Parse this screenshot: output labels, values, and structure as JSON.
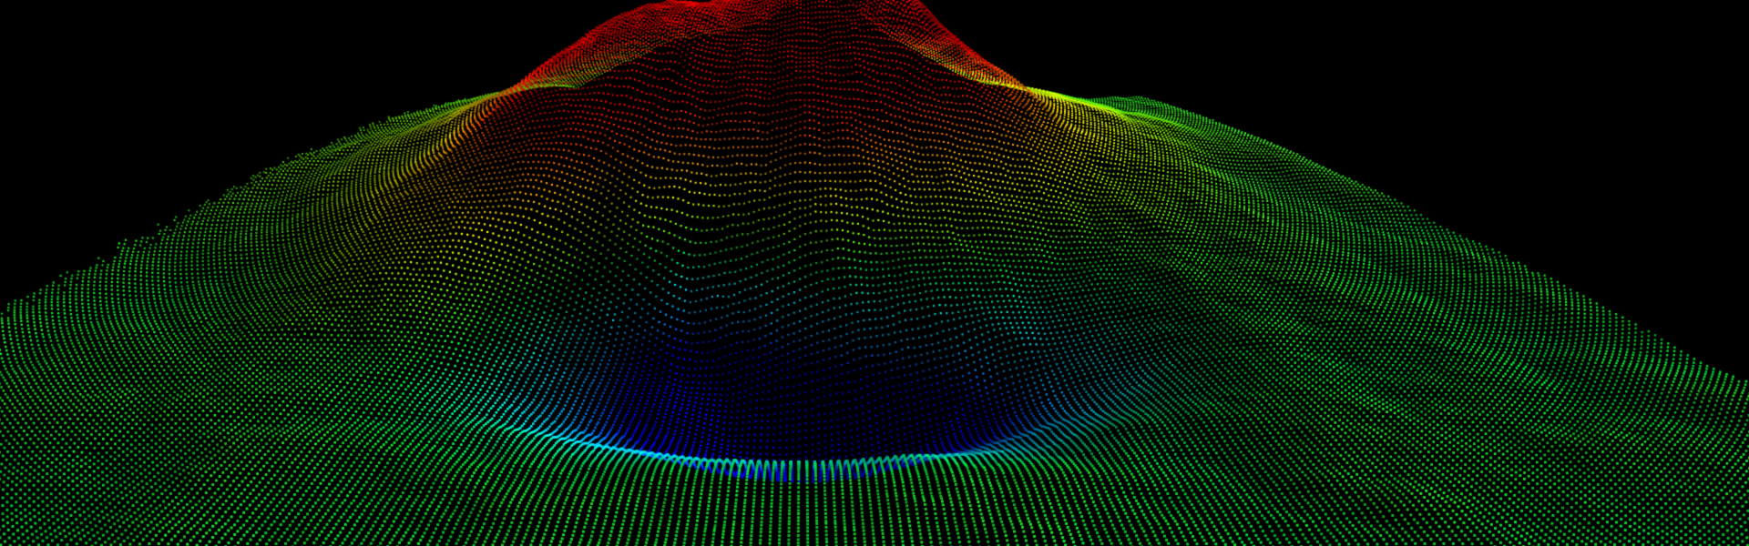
{
  "scene": {
    "type": "lidar-point-cloud-terrain",
    "background_color": "#000000",
    "color_ramp": [
      "#0000ff",
      "#00a0ff",
      "#00ffff",
      "#00ff40",
      "#80ff00",
      "#ffff00",
      "#ffa000",
      "#ff4000",
      "#ff0000"
    ],
    "features": [
      "mountain-ridge",
      "lake-basin",
      "flat-plain"
    ]
  }
}
